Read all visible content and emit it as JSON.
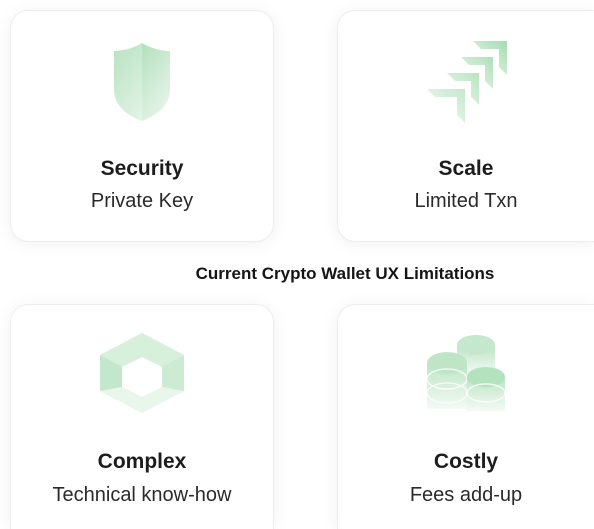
{
  "cards": [
    {
      "title": "Security",
      "subtitle": "Private Key",
      "icon": "shield-icon"
    },
    {
      "title": "Scale",
      "subtitle": "Limited Txn",
      "icon": "chevrons-up-right-icon"
    },
    {
      "title": "Complex",
      "subtitle": "Technical know-how",
      "icon": "cube-icon"
    },
    {
      "title": "Costly",
      "subtitle": "Fees add-up",
      "icon": "coins-icon"
    }
  ],
  "heading": "Current Crypto Wallet UX Limitations",
  "colors": {
    "icon_green": "#a9dcb4",
    "icon_green_light": "#e6f5e9",
    "text_dark": "#1d1d1d",
    "card_border": "#ededed"
  }
}
